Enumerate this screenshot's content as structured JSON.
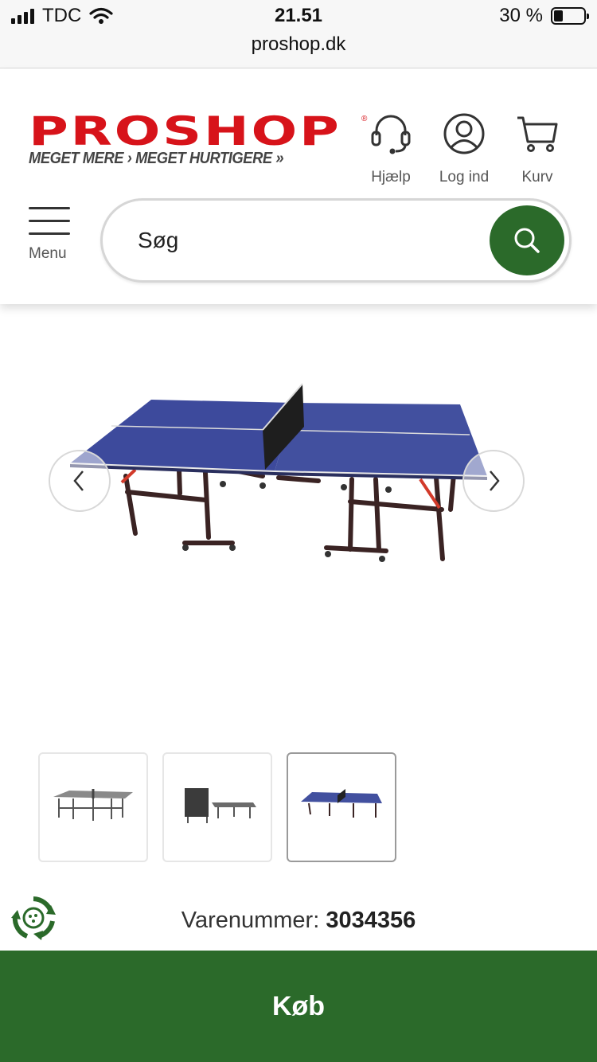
{
  "status_bar": {
    "carrier": "TDC",
    "time": "21.51",
    "url": "proshop.dk",
    "battery": "30 %",
    "battery_level": 0.3
  },
  "header": {
    "logo_text": "PROSHOP",
    "logo_registered": "®",
    "tagline": "MEGET MERE › MEGET HURTIGERE »",
    "help_label": "Hjælp",
    "login_label": "Log ind",
    "cart_label": "Kurv",
    "menu_label": "Menu",
    "brand_red": "#d7131a"
  },
  "search": {
    "placeholder": "Søg",
    "button_color": "#2b6a2a"
  },
  "product": {
    "image_icon": "table-tennis-table",
    "thumbnails": [
      "thumbnail-1",
      "thumbnail-2",
      "thumbnail-3"
    ],
    "active_thumbnail": 3,
    "sku_label": "Varenummer:",
    "sku_value": "3034356"
  },
  "buy_bar": {
    "label": "Køb",
    "color": "#2b6a2a"
  }
}
